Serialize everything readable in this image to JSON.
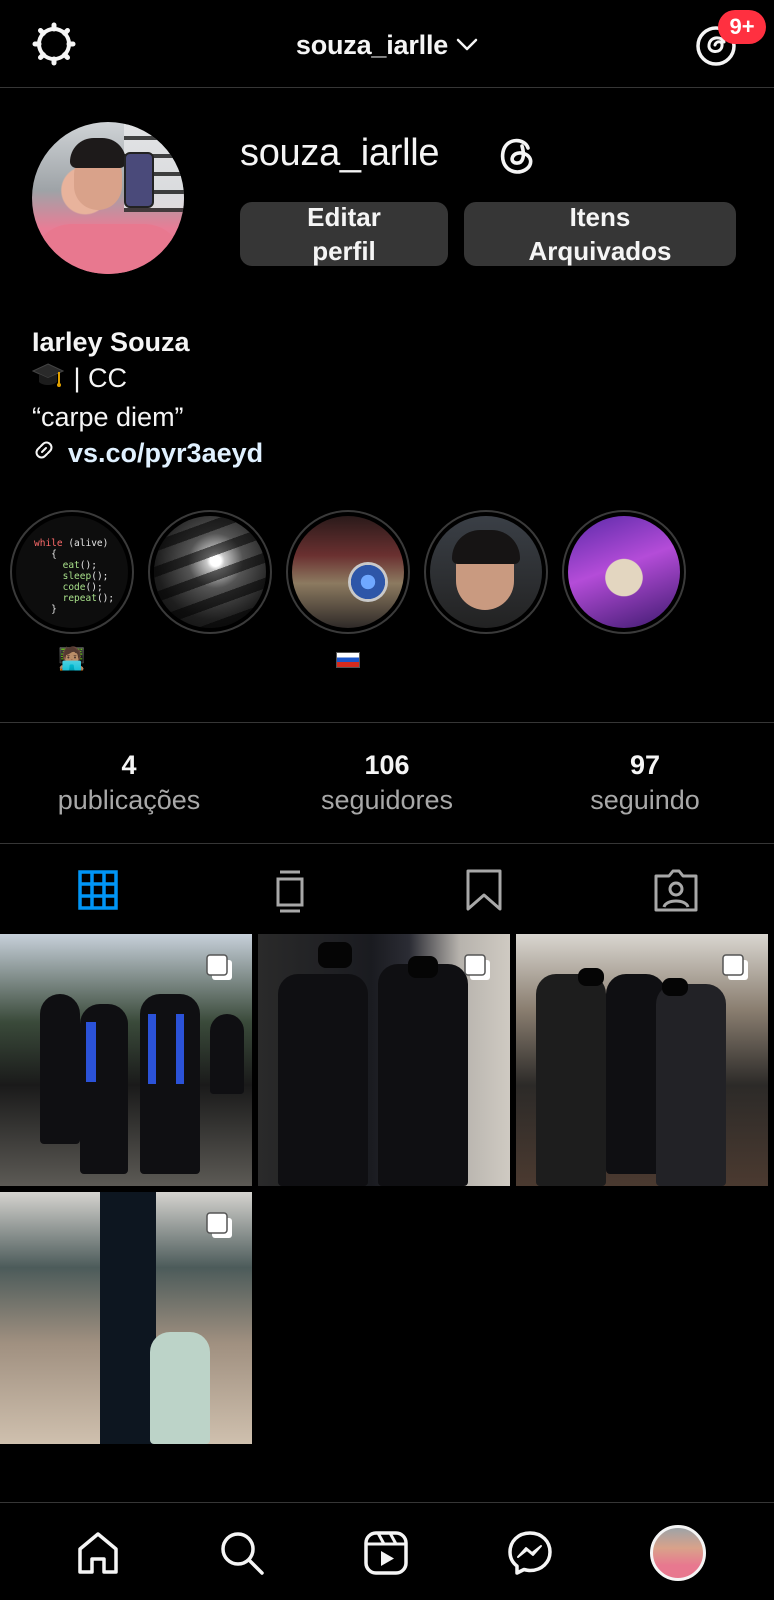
{
  "header": {
    "username": "souza_iarlle",
    "notif_badge": "9+"
  },
  "profile": {
    "handle": "souza_iarlle",
    "edit_line1": "Editar",
    "edit_line2": "perfil",
    "archive_line1": "Itens",
    "archive_line2": "Arquivados"
  },
  "bio": {
    "name": "Iarley Souza",
    "line1": " | CC",
    "line2": "“carpe diem”",
    "link": "vs.co/pyr3aeyd"
  },
  "highlights": [
    {
      "label": "🧑🏽‍💻",
      "icon": "code-picture"
    },
    {
      "label": "",
      "icon": "moon-picture"
    },
    {
      "label": "🇷🇺",
      "icon": "car-picture"
    },
    {
      "label": "",
      "icon": "selfie-picture"
    },
    {
      "label": "",
      "icon": "game-picture"
    }
  ],
  "stats": [
    {
      "num": "4",
      "label": "publicações"
    },
    {
      "num": "106",
      "label": "seguidores"
    },
    {
      "num": "97",
      "label": "seguindo"
    }
  ],
  "tabs": [
    "grid-icon",
    "guides-icon",
    "saved-icon",
    "tagged-icon"
  ],
  "active_tab_color": "#0095f6",
  "bottom_nav": [
    "home-icon",
    "search-icon",
    "reels-icon",
    "messenger-icon",
    "profile-avatar"
  ],
  "colors": {
    "background": "#000000",
    "button": "#363636",
    "badge": "#ff3040",
    "link": "#e0f1ff",
    "muted": "#a8a8a8"
  }
}
